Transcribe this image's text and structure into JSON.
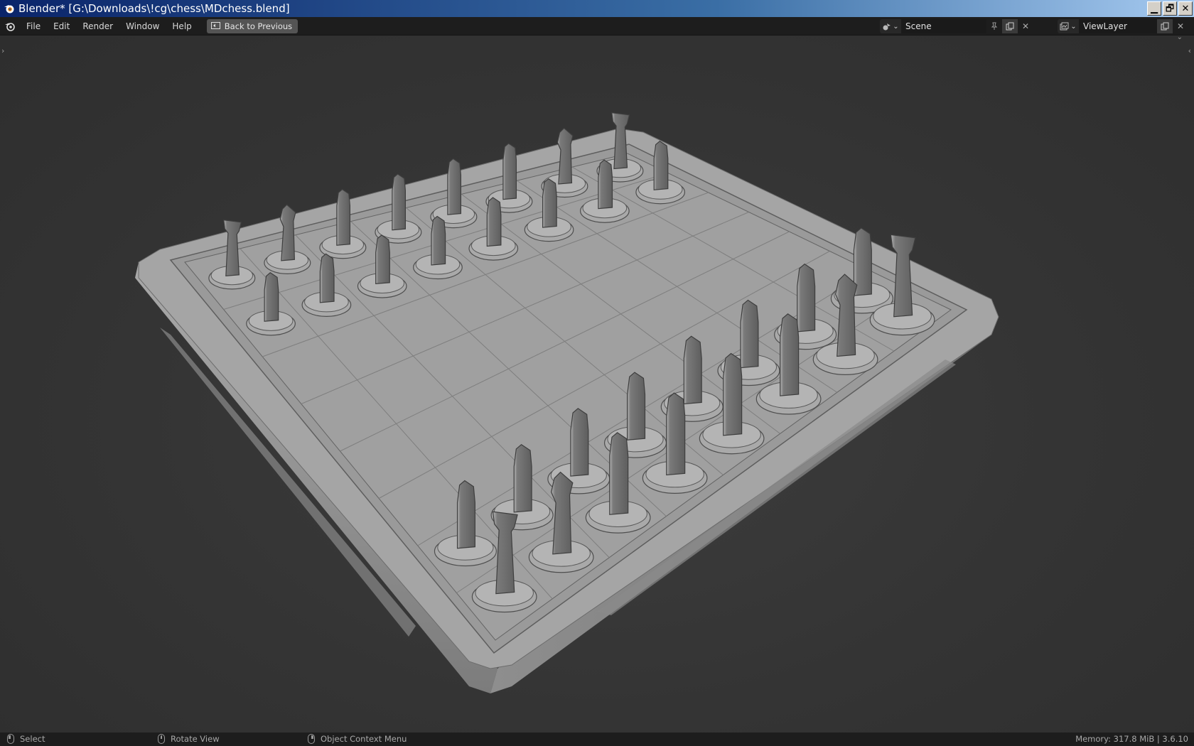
{
  "window": {
    "title": "Blender* [G:\\Downloads\\!cg\\chess\\MDchess.blend]",
    "controls": {
      "minimize": "▁",
      "restore": "🗗",
      "close": "✕"
    }
  },
  "menubar": {
    "items": [
      "File",
      "Edit",
      "Render",
      "Window",
      "Help"
    ],
    "back_button": "Back to Previous",
    "scene": {
      "value": "Scene"
    },
    "view_layer": {
      "value": "ViewLayer"
    }
  },
  "viewport": {
    "background": "#3a3a3a",
    "board_color": "#9c9c9c",
    "piece_color": "#6e6e6e"
  },
  "statusbar": {
    "select": "Select",
    "rotate": "Rotate View",
    "context": "Object Context Menu",
    "memory": "Memory: 317.8 MiB | 3.6.10"
  }
}
